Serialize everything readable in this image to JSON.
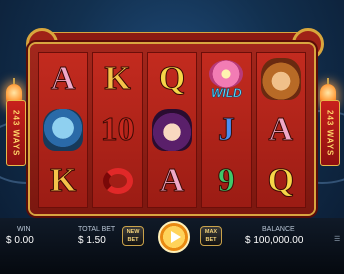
{
  "side_banner_text": "243 WAYS",
  "reels": [
    [
      {
        "type": "letter",
        "text": "A",
        "cls": "c-a"
      },
      {
        "type": "char",
        "cls": "demon",
        "name": "demon-symbol"
      },
      {
        "type": "letter",
        "text": "K",
        "cls": "c-k"
      }
    ],
    [
      {
        "type": "letter",
        "text": "K",
        "cls": "c-k"
      },
      {
        "type": "letter",
        "text": "10",
        "cls": "c-10"
      },
      {
        "type": "snake",
        "name": "snake-symbol"
      }
    ],
    [
      {
        "type": "letter",
        "text": "Q",
        "cls": "c-q"
      },
      {
        "type": "char",
        "cls": "girl",
        "name": "girl-symbol"
      },
      {
        "type": "letter",
        "text": "A",
        "cls": "c-a"
      }
    ],
    [
      {
        "type": "wild",
        "name": "wild-lotus-symbol",
        "label": "WILD"
      },
      {
        "type": "letter",
        "text": "J",
        "cls": "c-j"
      },
      {
        "type": "letter",
        "text": "9",
        "cls": "c-9"
      }
    ],
    [
      {
        "type": "char",
        "cls": "monkey",
        "name": "monkey-king-symbol"
      },
      {
        "type": "letter",
        "text": "A",
        "cls": "c-a"
      },
      {
        "type": "letter",
        "text": "Q",
        "cls": "c-q"
      }
    ]
  ],
  "footer": {
    "win_label": "WIN",
    "win_value": "$ 0.00",
    "total_bet_label": "TOTAL BET",
    "total_bet_value": "$ 1.50",
    "new_bet_label": "NEW BET",
    "max_bet_label": "MAX BET",
    "balance_label": "BALANCE",
    "balance_value": "$ 100,000.00"
  },
  "colors": {
    "reel_bg": "#c32b1f",
    "frame_gold": "#d9a540",
    "spin_button": "#ffd35a"
  }
}
